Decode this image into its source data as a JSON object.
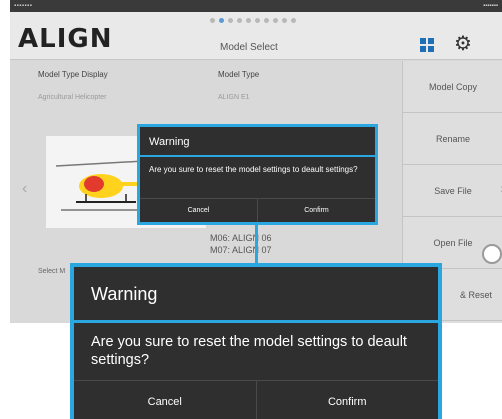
{
  "app": {
    "logo": "ALIGN",
    "screen_title": "Model Select"
  },
  "status_bar": {
    "left": "▪▪▪▪▪▪▪",
    "right": "▪▪▪▪▪▪▪"
  },
  "header": {
    "page_indicator": {
      "count": 10,
      "active_index": 1
    },
    "icons": [
      "grid-icon",
      "gear-icon"
    ]
  },
  "fields": {
    "model_type_display_label": "Model Type Display",
    "model_type_display_value": "Agricultural Helicopter",
    "model_type_label": "Model Type",
    "model_type_value": "ALIGN E1"
  },
  "model_list": [
    "M06:   ALIGN 06",
    "M07:   ALIGN 07"
  ],
  "select_label": "Select M",
  "sidebar": {
    "items": [
      {
        "label": "Model Copy"
      },
      {
        "label": "Rename"
      },
      {
        "label": "Save File"
      },
      {
        "label": "Open File"
      },
      {
        "label": "& Reset"
      }
    ]
  },
  "dialog": {
    "title": "Warning",
    "message": "Are you sure to reset the model settings to deault settings?",
    "cancel_label": "Cancel",
    "confirm_label": "Confirm"
  },
  "colors": {
    "accent": "#2aa7e1",
    "dialog_bg": "#2f2f2f",
    "grid_icon": "#1e6fb5"
  }
}
